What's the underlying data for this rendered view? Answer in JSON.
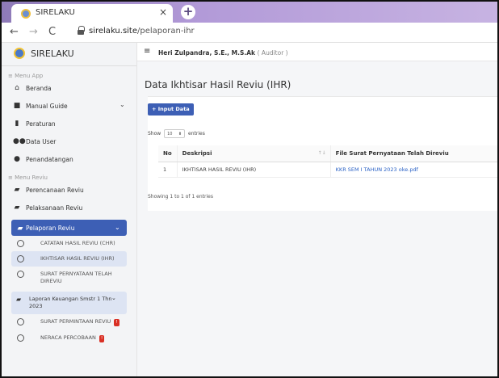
{
  "browser": {
    "tab_title": "SIRELAKU",
    "close_glyph": "×",
    "newtab_glyph": "+",
    "url_host": "sirelaku.site",
    "url_path": "/pelaporan-ihr"
  },
  "sidebar": {
    "brand": "SIRELAKU",
    "section_menu_app": "≡ Menu App",
    "menu_app": [
      {
        "label": "Beranda",
        "icon": "home-icon"
      },
      {
        "label": "Manual Guide",
        "icon": "book-icon",
        "has_chevron": true
      },
      {
        "label": "Peraturan",
        "icon": "bookmark-icon"
      },
      {
        "label": "Data User",
        "icon": "users-icon"
      },
      {
        "label": "Penandatangan",
        "icon": "user-icon"
      }
    ],
    "section_menu_reviu": "≡ Menu Reviu",
    "menu_reviu": [
      {
        "label": "Perencanaan Reviu",
        "icon": "file-icon"
      },
      {
        "label": "Pelaksanaan Reviu",
        "icon": "file-icon"
      }
    ],
    "active_item": "Pelaporan Reviu",
    "sub_items": [
      "CATATAN HASIL REVIU (CHR)",
      "IKHTISAR HASIL REVIU (IHR)",
      "SURAT PERNYATAAN TELAH DIREVIU"
    ],
    "group_item": "Laporan Keuangan Smstr 1 Thn 2023",
    "group_sub_items": [
      {
        "label": "SURAT PERMINTAAN REVIU",
        "badge": "!"
      },
      {
        "label": "NERACA PERCOBAAN",
        "badge": "!"
      }
    ]
  },
  "header": {
    "user_name": "Heri Zulpandra, S.E., M.S.Ak",
    "user_role": "( Auditor )"
  },
  "main": {
    "title": "Data Ikhtisar Hasil Reviu (IHR)",
    "input_button": "Input Data",
    "show_label": "Show",
    "entries_label": "entries",
    "page_size": "10",
    "columns": [
      "No",
      "Deskripsi",
      "File Surat Pernyataan Telah Direviu"
    ],
    "rows": [
      {
        "no": "1",
        "deskripsi": "IKHTISAR HASIL REVIU (IHR)",
        "file": "KKR SEM I TAHUN 2023 oke.pdf"
      }
    ],
    "showing_text": "Showing 1 to 1 of 1 entries"
  },
  "colors": {
    "primary": "#3d5fb5",
    "tabbar": "#b29ad8",
    "link": "#2c63c6",
    "badge": "#d93025"
  }
}
